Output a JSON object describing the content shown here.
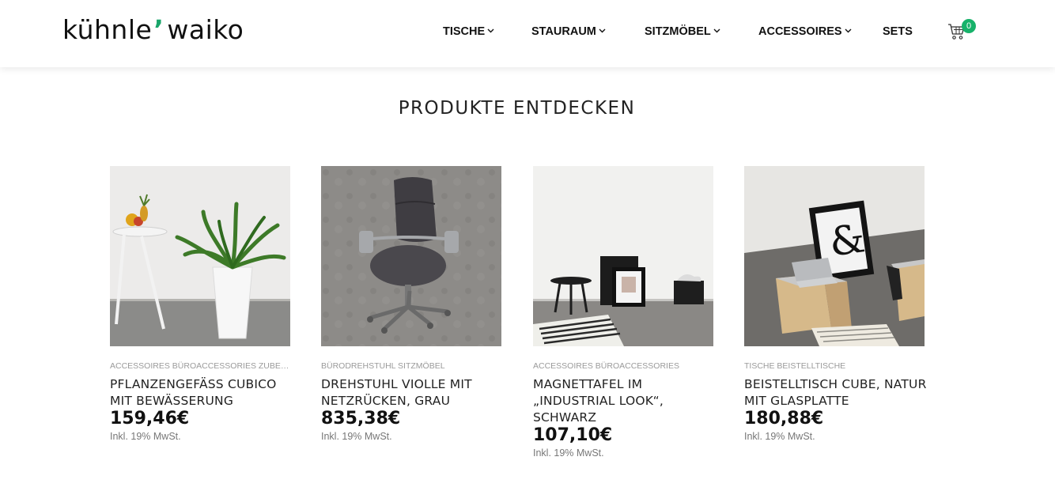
{
  "header": {
    "logo_left": "kühnle",
    "logo_mark": "’",
    "logo_right": "waiko",
    "nav": [
      {
        "label": "TISCHE",
        "has_dropdown": true
      },
      {
        "label": "STAURAUM",
        "has_dropdown": true
      },
      {
        "label": "SITZMÖBEL",
        "has_dropdown": true
      },
      {
        "label": "ACCESSOIRES",
        "has_dropdown": true
      },
      {
        "label": "SETS",
        "has_dropdown": false
      }
    ],
    "cart": {
      "icon": "shopping-cart-icon",
      "count": "0"
    }
  },
  "main": {
    "title": "PRODUKTE ENTDECKEN",
    "products": [
      {
        "categories": "ACCESSOIRES BÜROACCESSORIES ZUBEHÖR",
        "name": "PFLANZENGEFÄSS CUBICO MIT BEWÄSSERUNG",
        "price": "159,46€",
        "tax": "Inkl. 19% MwSt.",
        "image": "plant-pot-photo"
      },
      {
        "categories": "BÜRODREHSTUHL SITZMÖBEL",
        "name": "DREHSTUHL VIOLLE MIT NETZRÜCKEN, GRAU",
        "price": "835,38€",
        "tax": "Inkl. 19% MwSt.",
        "image": "office-chair-photo"
      },
      {
        "categories": "ACCESSOIRES BÜROACCESSORIES",
        "name": "MAGNETTAFEL IM „INDUSTRIAL LOOK“, SCHWARZ",
        "price": "107,10€",
        "tax": "Inkl. 19% MwSt.",
        "image": "magnet-board-photo"
      },
      {
        "categories": "TISCHE BEISTELLTISCHE",
        "name": "BEISTELLTISCH CUBE, NATUR MIT GLASPLATTE",
        "price": "180,88€",
        "tax": "Inkl. 19% MwSt.",
        "image": "side-table-cube-photo"
      }
    ]
  },
  "colors": {
    "accent": "#17b26a",
    "text": "#111111",
    "muted": "#9a9a9a"
  }
}
